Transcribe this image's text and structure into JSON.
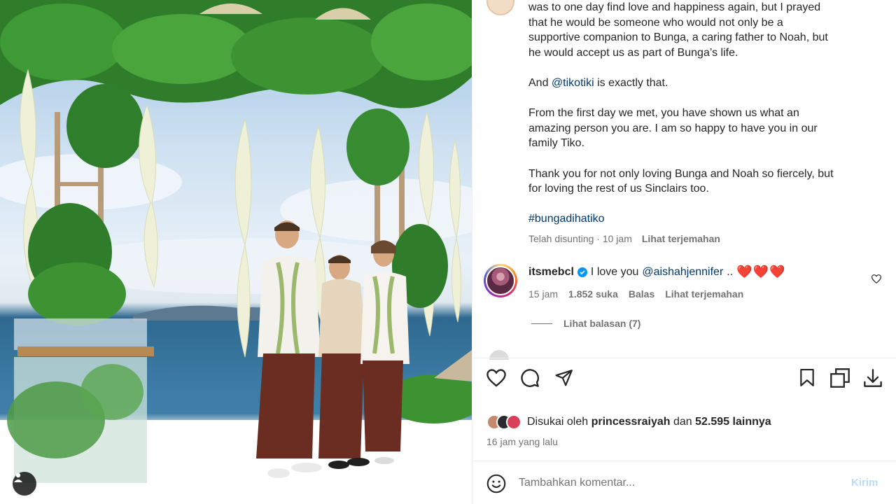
{
  "caption": {
    "lines": [
      "was to one day find love and happiness again, but I prayed",
      "that he would be someone who would not only be a",
      "supportive companion to Bunga, a caring father to Noah, but",
      "he would accept us as part of Bunga’s life."
    ],
    "line_and_prefix": "And ",
    "mention": "@tikotiki",
    "line_and_suffix": " is exactly that.",
    "para3": [
      "From the first day we met, you have shown us what an",
      "amazing person you are. I am so happy to have you in our",
      "family Tiko."
    ],
    "para4": [
      "Thank you for not only loving Bunga and Noah so fiercely, but",
      "for loving the rest of us Sinclairs too."
    ],
    "hashtag": "#bungadihatiko"
  },
  "meta": {
    "edited": "Telah disunting · 10 jam",
    "translate": "Lihat terjemahan"
  },
  "comment": {
    "username": "itsmebcl",
    "text_prefix": " I love you ",
    "mention": "@aishahjennifer",
    "text_suffix": " ..",
    "hearts": "❤️❤️❤️",
    "time": "15 jam",
    "likes": "1.852 suka",
    "reply": "Balas",
    "translate": "Lihat terjemahan",
    "view_replies": "Lihat balasan (7)"
  },
  "icons": {
    "like": "heart-icon",
    "comment": "comment-icon",
    "share": "send-icon",
    "save": "bookmark-icon",
    "collection": "copy-icon",
    "download": "download-icon",
    "emoji": "emoji-icon",
    "tag": "user-tag-icon"
  },
  "likes": {
    "prefix": "Disukai oleh ",
    "user": "princessraiyah",
    "middle": " dan ",
    "others": "52.595 lainnya"
  },
  "post_time": "16 jam yang lalu",
  "comment_box": {
    "placeholder": "Tambahkan komentar...",
    "send_label": "Kirim"
  },
  "colors": {
    "link": "#00376b",
    "verified": "#0095f6",
    "send_disabled": "#b8dcfc",
    "muted": "#737373"
  }
}
